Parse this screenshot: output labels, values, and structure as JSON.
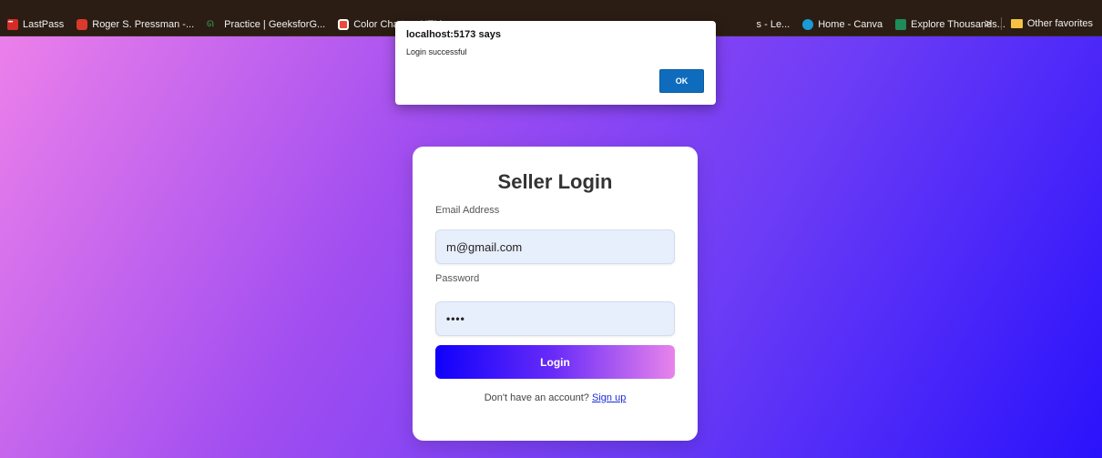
{
  "bookmarks": {
    "items": [
      {
        "label": "LastPass",
        "icon": "lastpass-icon"
      },
      {
        "label": "Roger S. Pressman -...",
        "icon": "pdf-icon"
      },
      {
        "label": "Practice | GeeksforG...",
        "icon": "geeksforgeeks-icon"
      },
      {
        "label": "Color Chart — HTM...",
        "icon": "color-chart-icon"
      },
      {
        "label": "s - Le...",
        "icon": ""
      },
      {
        "label": "Home - Canva",
        "icon": "canva-icon"
      },
      {
        "label": "Explore Thousands...",
        "icon": "explore-icon"
      }
    ],
    "overflow": ">",
    "other_favorites": "Other favorites"
  },
  "dialog": {
    "title": "localhost:5173 says",
    "message": "Login successful",
    "ok_label": "OK"
  },
  "login": {
    "title": "Seller Login",
    "email_label": "Email Address",
    "email_value": "m@gmail.com",
    "password_label": "Password",
    "password_value": "••••",
    "button_label": "Login",
    "signup_prompt": "Don't have an account?",
    "signup_link": "Sign up"
  },
  "colors": {
    "gradient_start": "#ec80ea",
    "gradient_end": "#2a12fb",
    "ok_button": "#0f6cbd",
    "link": "#1b2bd8"
  }
}
